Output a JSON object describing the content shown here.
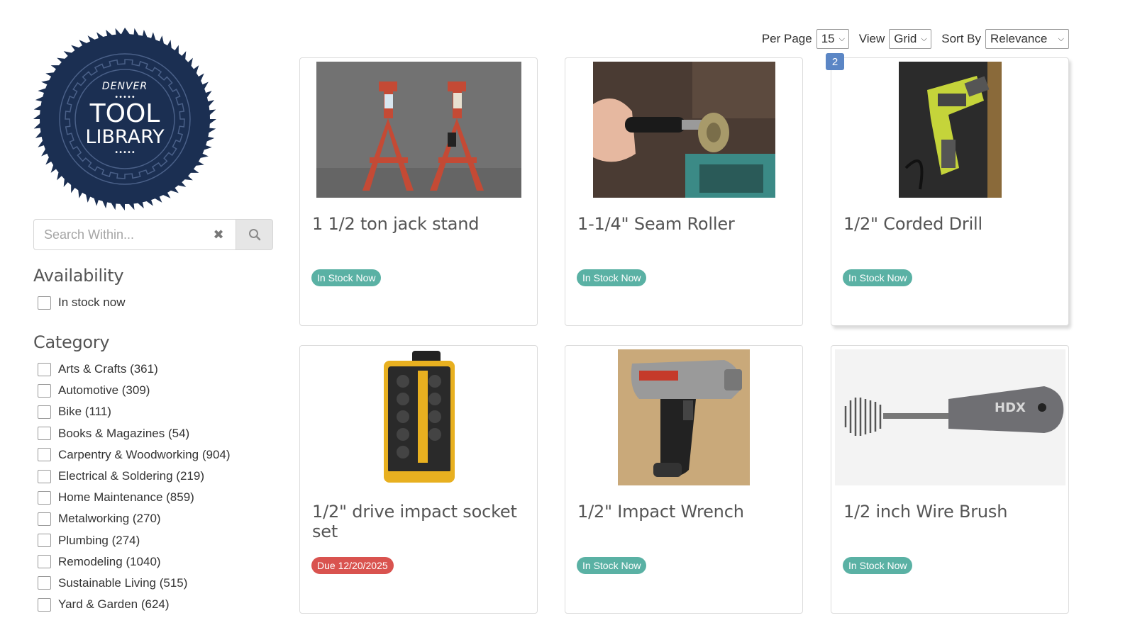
{
  "logo": {
    "top_text": "DENVER",
    "line1": "TOOL",
    "line2": "LIBRARY",
    "color": "#1b2f52"
  },
  "search": {
    "placeholder": "Search Within...",
    "value": ""
  },
  "availability": {
    "title": "Availability",
    "options": [
      {
        "label": "In stock now",
        "checked": false
      }
    ]
  },
  "category": {
    "title": "Category",
    "options": [
      {
        "label": "Arts & Crafts (361)",
        "checked": false
      },
      {
        "label": "Automotive (309)",
        "checked": false
      },
      {
        "label": "Bike (111)",
        "checked": false
      },
      {
        "label": "Books & Magazines (54)",
        "checked": false
      },
      {
        "label": "Carpentry & Woodworking (904)",
        "checked": false
      },
      {
        "label": "Electrical & Soldering (219)",
        "checked": false
      },
      {
        "label": "Home Maintenance (859)",
        "checked": false
      },
      {
        "label": "Metalworking (270)",
        "checked": false
      },
      {
        "label": "Plumbing (274)",
        "checked": false
      },
      {
        "label": "Remodeling (1040)",
        "checked": false
      },
      {
        "label": "Sustainable Living (515)",
        "checked": false
      },
      {
        "label": "Yard & Garden (624)",
        "checked": false
      }
    ]
  },
  "toolbar": {
    "per_page_label": "Per Page",
    "per_page_value": "15",
    "view_label": "View",
    "view_value": "Grid",
    "sort_label": "Sort By",
    "sort_value": "Relevance",
    "page_badge": "2"
  },
  "items": [
    {
      "title": "1 1/2 ton jack stand",
      "status": "In Stock Now",
      "status_type": "stock",
      "image": "jack-stands-photo"
    },
    {
      "title": "1-1/4\" Seam Roller",
      "status": "In Stock Now",
      "status_type": "stock",
      "image": "seam-roller-photo"
    },
    {
      "title": "1/2\" Corded Drill",
      "status": "In Stock Now",
      "status_type": "stock",
      "image": "corded-drill-photo"
    },
    {
      "title": "1/2\" drive impact socket set",
      "status": "Due 12/20/2025",
      "status_type": "due",
      "image": "socket-set-photo"
    },
    {
      "title": "1/2\" Impact Wrench",
      "status": "In Stock Now",
      "status_type": "stock",
      "image": "impact-wrench-photo"
    },
    {
      "title": "1/2 inch Wire Brush",
      "status": "In Stock Now",
      "status_type": "stock",
      "image": "wire-brush-photo"
    }
  ],
  "colors": {
    "in_stock": "#5ab1a4",
    "due": "#d9534f",
    "page_badge": "#5b86c5"
  }
}
